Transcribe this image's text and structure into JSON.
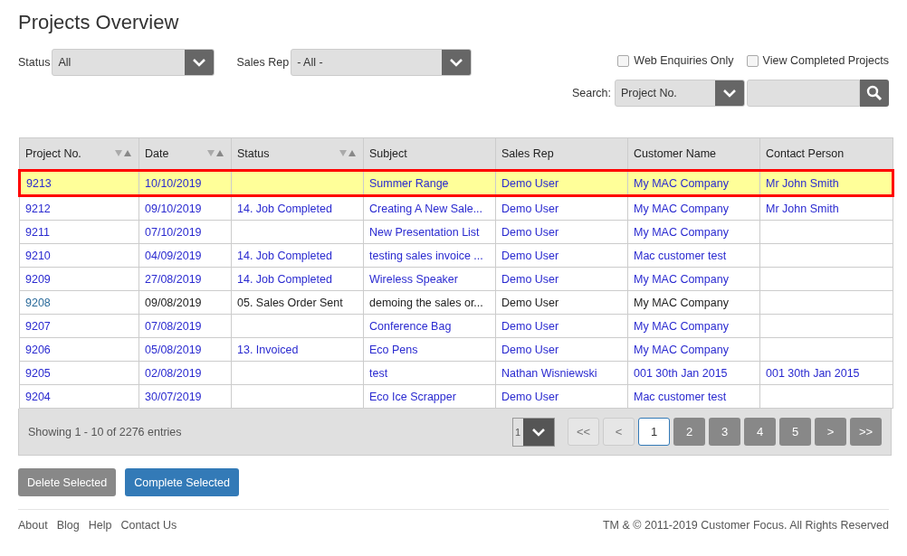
{
  "title": "Projects Overview",
  "filters": {
    "status": {
      "label": "Status",
      "value": "All"
    },
    "sales_rep": {
      "label": "Sales Rep",
      "value": "- All -"
    },
    "checkboxes": [
      {
        "label": "Web Enquiries Only",
        "checked": false
      },
      {
        "label": "View Completed Projects",
        "checked": false
      }
    ],
    "search": {
      "label": "Search:",
      "field": "Project No."
    }
  },
  "table": {
    "columns": [
      {
        "label": "Project No.",
        "sortable": true
      },
      {
        "label": "Date",
        "sortable": true
      },
      {
        "label": "Status",
        "sortable": true
      },
      {
        "label": "Subject",
        "sortable": false
      },
      {
        "label": "Sales Rep",
        "sortable": false
      },
      {
        "label": "Customer Name",
        "sortable": false
      },
      {
        "label": "Contact Person",
        "sortable": false
      }
    ],
    "rows": [
      {
        "selected": true,
        "linked": true,
        "cells": [
          "9213",
          "10/10/2019",
          "",
          "Summer Range",
          "Demo User",
          "My MAC Company",
          "Mr John Smith"
        ]
      },
      {
        "selected": false,
        "linked": true,
        "cells": [
          "9212",
          "09/10/2019",
          "14. Job Completed",
          "Creating A New Sale...",
          "Demo User",
          "My MAC Company",
          "Mr John Smith"
        ]
      },
      {
        "selected": false,
        "linked": true,
        "cells": [
          "9211",
          "07/10/2019",
          "",
          "New Presentation List",
          "Demo User",
          "My MAC Company",
          ""
        ]
      },
      {
        "selected": false,
        "linked": true,
        "cells": [
          "9210",
          "04/09/2019",
          "14. Job Completed",
          "testing sales invoice ...",
          "Demo User",
          "Mac customer test",
          ""
        ]
      },
      {
        "selected": false,
        "linked": true,
        "cells": [
          "9209",
          "27/08/2019",
          "14. Job Completed",
          "Wireless Speaker",
          "Demo User",
          "My MAC Company",
          ""
        ]
      },
      {
        "selected": false,
        "linked": false,
        "cells": [
          "9208",
          "09/08/2019",
          "05. Sales Order Sent",
          "demoing the sales or...",
          "Demo User",
          "My MAC Company",
          ""
        ]
      },
      {
        "selected": false,
        "linked": true,
        "cells": [
          "9207",
          "07/08/2019",
          "",
          "Conference Bag",
          "Demo User",
          "My MAC Company",
          ""
        ]
      },
      {
        "selected": false,
        "linked": true,
        "cells": [
          "9206",
          "05/08/2019",
          "13. Invoiced",
          "Eco Pens",
          "Demo User",
          "My MAC Company",
          ""
        ]
      },
      {
        "selected": false,
        "linked": true,
        "cells": [
          "9205",
          "02/08/2019",
          "",
          "test",
          "Nathan Wisniewski",
          "001 30th Jan 2015",
          "001 30th Jan 2015"
        ]
      },
      {
        "selected": false,
        "linked": true,
        "cells": [
          "9204",
          "30/07/2019",
          "",
          "Eco Ice Scrapper",
          "Demo User",
          "Mac customer test",
          ""
        ]
      }
    ],
    "footer": {
      "summary": "Showing 1 - 10 of 2276 entries",
      "page_size": "1",
      "pages": [
        {
          "label": "<<",
          "disabled": true,
          "selected": false
        },
        {
          "label": "<",
          "disabled": true,
          "selected": false
        },
        {
          "label": "1",
          "disabled": false,
          "selected": true
        },
        {
          "label": "2",
          "disabled": false,
          "selected": false
        },
        {
          "label": "3",
          "disabled": false,
          "selected": false
        },
        {
          "label": "4",
          "disabled": false,
          "selected": false
        },
        {
          "label": "5",
          "disabled": false,
          "selected": false
        },
        {
          "label": ">",
          "disabled": false,
          "selected": false
        },
        {
          "label": ">>",
          "disabled": false,
          "selected": false
        }
      ]
    }
  },
  "actions": [
    {
      "label": "Delete Selected",
      "kind": "secondary"
    },
    {
      "label": "Complete Selected",
      "kind": "primary"
    }
  ],
  "links": [
    "About",
    "Blog",
    "Help",
    "Contact Us"
  ],
  "copyright": "TM & © 2011-2019 Customer Focus. All Rights Reserved"
}
